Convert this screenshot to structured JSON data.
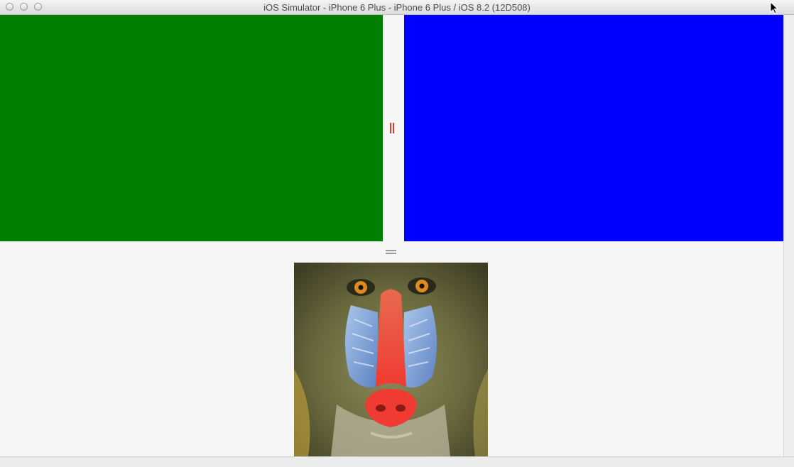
{
  "window": {
    "title": "iOS Simulator - iPhone 6 Plus - iPhone 6 Plus / iOS 8.2 (12D508)"
  },
  "panes": {
    "left_color": "#007f00",
    "right_color": "#0000ff",
    "background": "#f6f6f6"
  },
  "dividers": {
    "vertical_color": "#e03a2e",
    "horizontal_color": "#9b9b9b"
  },
  "icons": {
    "traffic_lights": [
      "close-icon",
      "minimize-icon",
      "zoom-icon"
    ],
    "cursor": "mouse-pointer-icon",
    "vertical_handle": "vertical-resize-handle-icon",
    "horizontal_handle": "horizontal-resize-handle-icon"
  }
}
